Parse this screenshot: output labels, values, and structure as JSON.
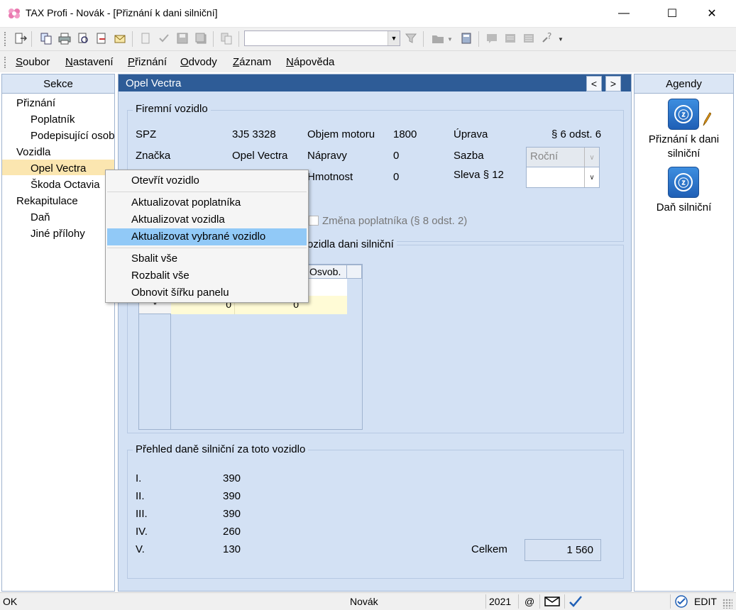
{
  "window": {
    "title": "TAX Profi - Novák - [Přiznání k dani silniční]",
    "minimize": "—",
    "maximize": "☐",
    "close": "✕"
  },
  "menubar": {
    "items": [
      "Soubor",
      "Nastavení",
      "Přiznání",
      "Odvody",
      "Záznam",
      "Nápověda"
    ]
  },
  "sections": {
    "header": "Sekce",
    "tree": [
      {
        "label": "Přiznání",
        "level": 0
      },
      {
        "label": "Poplatník",
        "level": 1
      },
      {
        "label": "Podepisující osoba",
        "level": 1
      },
      {
        "label": "Vozidla",
        "level": 0
      },
      {
        "label": "Opel Vectra",
        "level": 1,
        "selected": true
      },
      {
        "label": "Škoda Octavia",
        "level": 1
      },
      {
        "label": "Rekapitulace",
        "level": 0
      },
      {
        "label": "Daň",
        "level": 1
      },
      {
        "label": "Jiné přílohy",
        "level": 1
      }
    ]
  },
  "main": {
    "header": "Opel Vectra",
    "prev": "<",
    "next": ">",
    "vehicle_group": "Firemní vozidlo",
    "spz_label": "SPZ",
    "spz": "3J5 3328",
    "brand_label": "Značka",
    "brand": "Opel Vectra",
    "engine_label": "Objem motoru",
    "engine": "1800",
    "axles_label": "Nápravy",
    "axles": "0",
    "weight_label": "Hmotnost",
    "weight": "0",
    "adjust_label": "Úprava",
    "adjust": "§ 6 odst. 6",
    "rate_label": "Sazba",
    "rate_value": "Roční",
    "discount_label": "Sleva § 12",
    "change_payer_label": "Změna poplatníka (§ 8 odst. 2)",
    "period_group_fragment": "ozidla dani silniční",
    "grid": {
      "col_exempt": "Osvob.",
      "new_row_marker": "*",
      "row_val1": "0",
      "row_val2": "0"
    },
    "overview_group": "Přehled daně silniční za toto vozidlo",
    "quarters": [
      {
        "label": "I.",
        "value": "390"
      },
      {
        "label": "II.",
        "value": "390"
      },
      {
        "label": "III.",
        "value": "390"
      },
      {
        "label": "IV.",
        "value": "260"
      },
      {
        "label": "V.",
        "value": "130"
      }
    ],
    "total_label": "Celkem",
    "total": "1 560"
  },
  "context_menu": {
    "items": [
      "Otevřít vozidlo",
      "Aktualizovat poplatníka",
      "Aktualizovat vozidla",
      "Aktualizovat vybrané vozidlo",
      "Sbalit vše",
      "Rozbalit vše",
      "Obnovit šířku panelu"
    ],
    "highlighted": "Aktualizovat vybrané vozidlo"
  },
  "agendas": {
    "header": "Agendy",
    "items": [
      "Přiznání k dani silniční",
      "Daň silniční"
    ]
  },
  "status": {
    "state": "OK",
    "user": "Novák",
    "year": "2021",
    "at": "@",
    "mode": "EDIT"
  },
  "colors": {
    "accent": "#2e5c97",
    "panel_bg": "#d3e1f4",
    "selection": "#91c9f7",
    "tree_selection": "#fbe6b0"
  }
}
